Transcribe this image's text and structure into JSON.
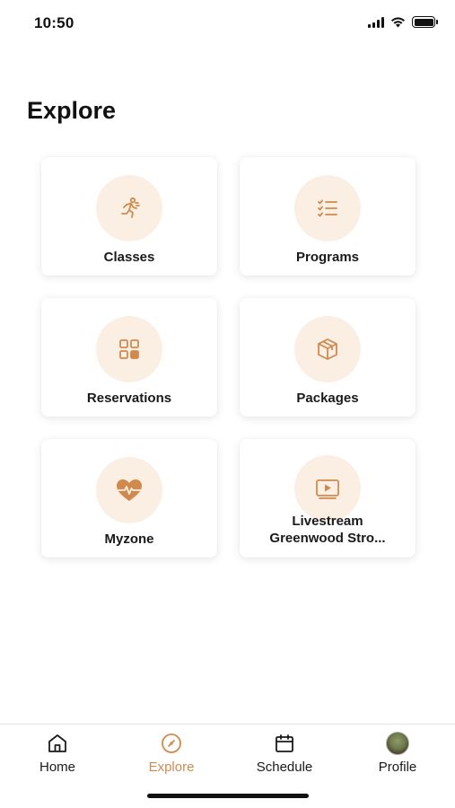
{
  "status_bar": {
    "time": "10:50"
  },
  "page": {
    "title": "Explore"
  },
  "tiles": [
    {
      "label": "Classes",
      "icon": "running-person-icon"
    },
    {
      "label": "Programs",
      "icon": "checklist-icon"
    },
    {
      "label": "Reservations",
      "icon": "grid-squares-icon"
    },
    {
      "label": "Packages",
      "icon": "package-box-icon"
    },
    {
      "label": "Myzone",
      "icon": "heart-pulse-icon"
    },
    {
      "label_line1": "Livestream",
      "label_line2": "Greenwood Stro...",
      "icon": "video-play-icon"
    }
  ],
  "tab_bar": {
    "tabs": [
      {
        "label": "Home",
        "icon": "home-icon",
        "active": false
      },
      {
        "label": "Explore",
        "icon": "compass-icon",
        "active": true
      },
      {
        "label": "Schedule",
        "icon": "calendar-icon",
        "active": false
      },
      {
        "label": "Profile",
        "icon": "avatar",
        "active": false
      }
    ]
  },
  "colors": {
    "accent": "#d08a4e",
    "icon_bg": "#fbefe4",
    "text": "#1a1a1a"
  }
}
